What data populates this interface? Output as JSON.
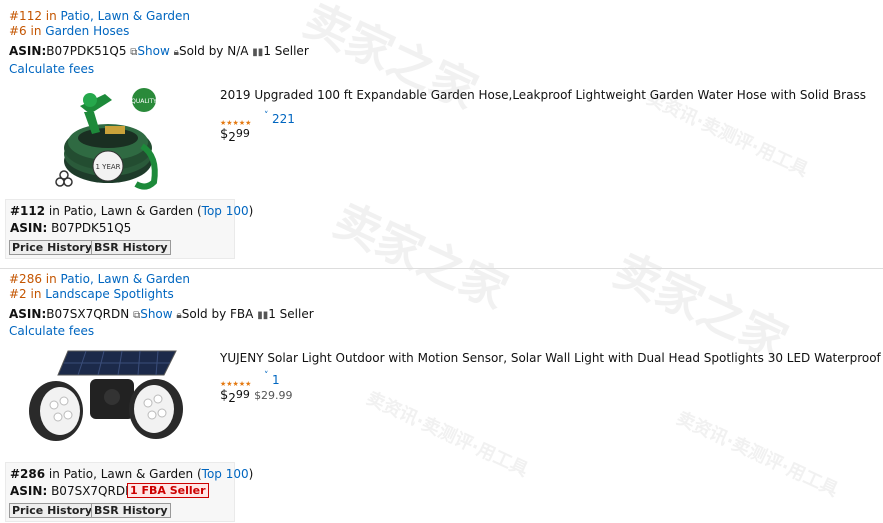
{
  "products": [
    {
      "rank1_num": "#112",
      "rank1_in": " in ",
      "rank1_cat": "Patio, Lawn & Garden",
      "rank2_num": "#6",
      "rank2_in": " in ",
      "rank2_cat": "Garden Hoses",
      "asin_label": "ASIN:",
      "asin": "B07PDK51Q5",
      "show_label": "Show",
      "sold_by": "Sold by N/A",
      "sellers": "1 Seller",
      "calc_fees": "Calculate fees",
      "title": "2019 Upgraded 100 ft Expandable Garden Hose,Leakproof Lightweight Garden Water Hose with Solid Brass",
      "stars": "★★★★★",
      "rating": 4.5,
      "review_count": "221",
      "price_symbol": "$",
      "price_whole": "2",
      "price_frac": "99",
      "list_price": "",
      "box_rank": "#112",
      "box_rank_in": " in Patio, Lawn & Garden (",
      "box_top": "Top 100",
      "box_close": ")",
      "box_asin_label": "ASIN:",
      "box_asin": "B07PDK51Q5",
      "fba_badge": "",
      "price_history": "Price History",
      "bsr_history": "BSR History"
    },
    {
      "rank1_num": "#286",
      "rank1_in": " in ",
      "rank1_cat": "Patio, Lawn & Garden",
      "rank2_num": "#2",
      "rank2_in": " in ",
      "rank2_cat": "Landscape Spotlights",
      "asin_label": "ASIN:",
      "asin": "B07SX7QRDN",
      "show_label": "Show",
      "sold_by": "Sold by FBA",
      "sellers": "1 Seller",
      "calc_fees": "Calculate fees",
      "title": "YUJENY Solar Light Outdoor with Motion Sensor, Solar Wall Light with Dual Head Spotlights 30 LED Waterproof",
      "stars": "★★★★★",
      "rating": 5,
      "review_count": "1",
      "price_symbol": "$",
      "price_whole": "2",
      "price_frac": "99",
      "list_price": "$29.99",
      "box_rank": "#286",
      "box_rank_in": " in Patio, Lawn & Garden (",
      "box_top": "Top 100",
      "box_close": ")",
      "box_asin_label": "ASIN:",
      "box_asin": "B07SX7QRDN",
      "fba_badge": "1 FBA Seller",
      "price_history": "Price History",
      "bsr_history": "BSR History"
    }
  ],
  "watermark": {
    "text_large": "卖家之家",
    "text_small": "卖资讯·卖测评·用工具"
  },
  "colors": {
    "rank_number": "#c45500",
    "link": "#0066c0",
    "star": "#e47911",
    "fba_red": "#cc0000"
  }
}
